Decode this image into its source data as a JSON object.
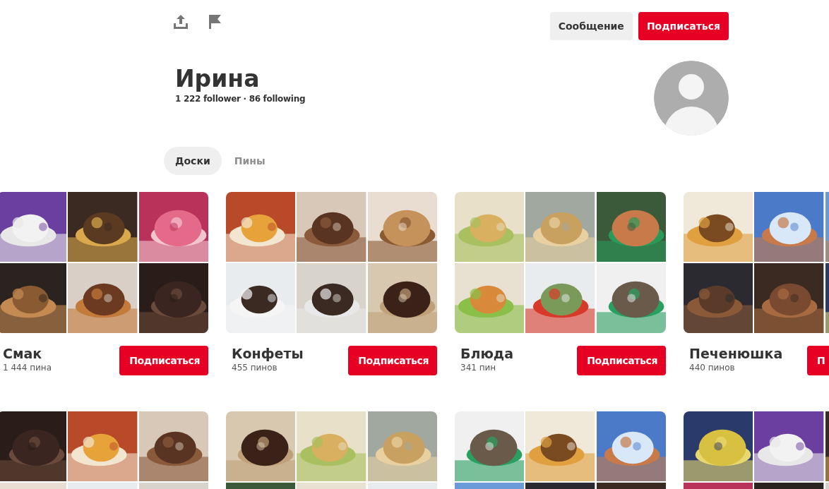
{
  "toolbar": {
    "buttons": [
      {
        "label": "Сообщение",
        "kind": "secondary"
      },
      {
        "label": "Подписаться",
        "kind": "primary"
      }
    ]
  },
  "profile": {
    "name": "Ирина",
    "stats": "1 222 follower · 86 following",
    "avatar": {
      "kind": "placeholder"
    }
  },
  "tabs": [
    {
      "label": "Доски",
      "selected": true
    },
    {
      "label": "Пины",
      "selected": false
    }
  ],
  "boards": [
    {
      "name": "Смак",
      "count": "1 444 пина",
      "button": "Подписаться",
      "cover": {
        "kind": "picture"
      }
    },
    {
      "name": "Конфеты",
      "count": "455 пинов",
      "button": "Подписаться",
      "cover": {
        "kind": "picture"
      }
    },
    {
      "name": "Блюда",
      "count": "341 пин",
      "button": "Подписаться",
      "cover": {
        "kind": "picture"
      }
    },
    {
      "name": "Печенюшка",
      "count": "440 пинов",
      "button": "П",
      "cover": {
        "kind": "picture"
      }
    },
    {
      "cover": {
        "kind": "picture"
      }
    },
    {
      "cover": {
        "kind": "picture"
      }
    },
    {
      "cover": {
        "kind": "picture"
      }
    },
    {
      "cover": {
        "kind": "picture"
      }
    }
  ]
}
